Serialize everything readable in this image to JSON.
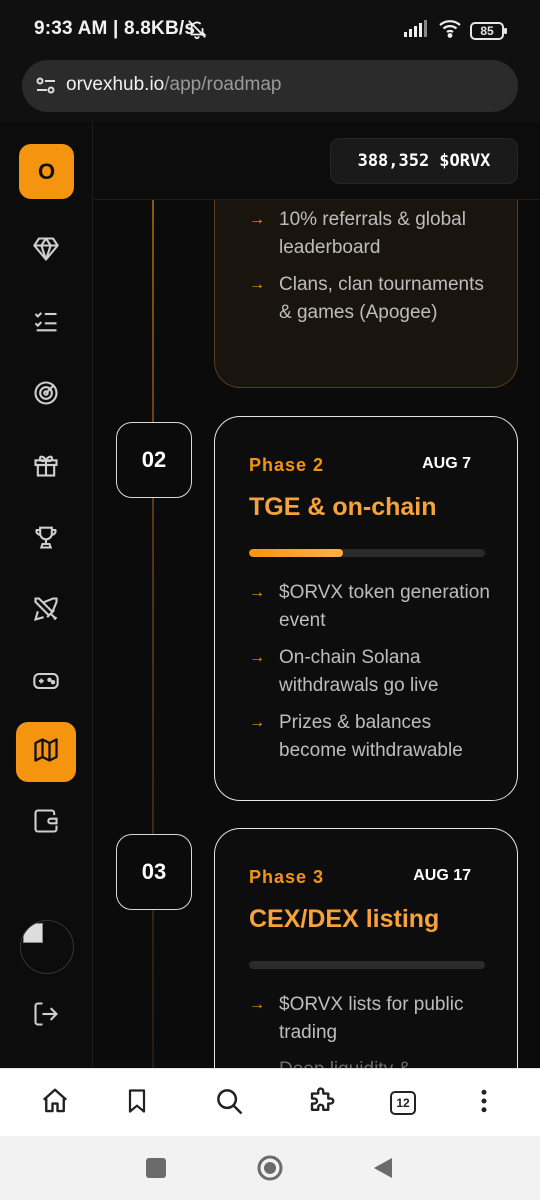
{
  "status": {
    "time": "9:33 AM",
    "speed": "8.8KB/s",
    "battery": "85"
  },
  "url": {
    "host": "orvexhub.io",
    "path": "/app/roadmap"
  },
  "sidebar": {
    "logo": "O",
    "items": [
      {
        "icon": "diamond-icon"
      },
      {
        "icon": "checklist-icon"
      },
      {
        "icon": "target-icon"
      },
      {
        "icon": "gift-icon"
      },
      {
        "icon": "trophy-icon"
      },
      {
        "icon": "swords-icon"
      },
      {
        "icon": "gamepad-icon"
      },
      {
        "icon": "map-icon",
        "active": true
      },
      {
        "icon": "wallet-icon"
      }
    ],
    "logout_icon": "logout-icon"
  },
  "header": {
    "balance_amount": "388,352",
    "balance_token": "$ORVX"
  },
  "roadmap": {
    "prev_card": {
      "bullets": [
        "10% referrals & global leaderboard",
        "Clans, clan tournaments & games (Apogee)"
      ]
    },
    "phases": [
      {
        "number": "02",
        "label": "Phase 2",
        "date": "AUG 7",
        "title": "TGE & on-chain",
        "progress": 0.4,
        "bullets": [
          "$ORVX token generation event",
          "On-chain Solana withdrawals go live",
          "Prizes & balances become withdrawable"
        ]
      },
      {
        "number": "03",
        "label": "Phase 3",
        "date": "AUG 17",
        "title": "CEX/DEX listing",
        "progress": 0,
        "bullets": [
          "$ORVX lists for public trading",
          "Deep liquidity &"
        ]
      }
    ]
  },
  "browser_nav": {
    "tabs_count": "12"
  },
  "colors": {
    "accent": "#f5950f",
    "background": "#0b0b0b"
  }
}
